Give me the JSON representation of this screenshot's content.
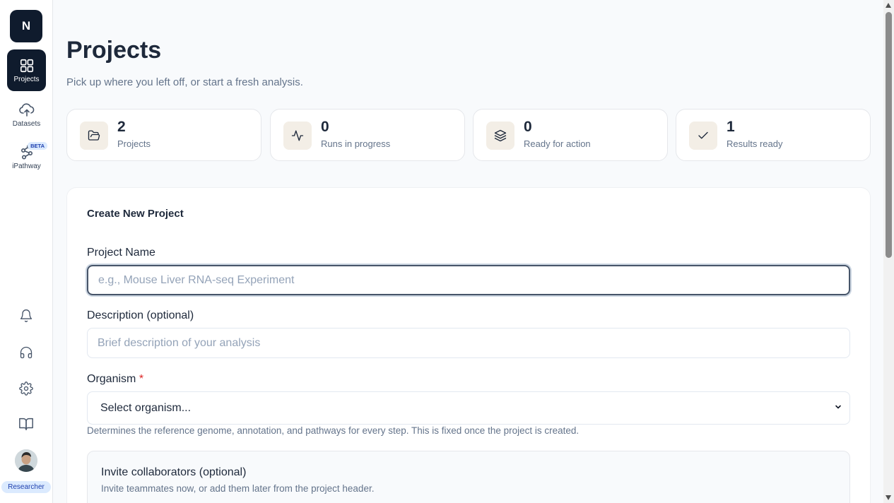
{
  "sidebar": {
    "logo_letter": "N",
    "nav": [
      {
        "label": "Projects",
        "icon": "grid-icon",
        "active": true
      },
      {
        "label": "Datasets",
        "icon": "cloud-upload-icon"
      },
      {
        "label": "iPathway",
        "icon": "pathway-icon",
        "badge": "BETA"
      }
    ],
    "utility_icons": [
      "bell-icon",
      "headphones-icon",
      "gear-icon",
      "book-icon"
    ],
    "role_badge": "Researcher"
  },
  "header": {
    "title": "Projects",
    "subtitle": "Pick up where you left off, or start a fresh analysis."
  },
  "stats": [
    {
      "value": "2",
      "label": "Projects",
      "icon": "folder-open-icon"
    },
    {
      "value": "0",
      "label": "Runs in progress",
      "icon": "activity-icon"
    },
    {
      "value": "0",
      "label": "Ready for action",
      "icon": "layers-icon"
    },
    {
      "value": "1",
      "label": "Results ready",
      "icon": "check-icon"
    }
  ],
  "form": {
    "title": "Create New Project",
    "project_name": {
      "label": "Project Name",
      "placeholder": "e.g., Mouse Liver RNA-seq Experiment",
      "value": ""
    },
    "description": {
      "label": "Description (optional)",
      "placeholder": "Brief description of your analysis",
      "value": ""
    },
    "organism": {
      "label": "Organism",
      "required_mark": "*",
      "selected": "Select organism...",
      "help": "Determines the reference genome, annotation, and pathways for every step. This is fixed once the project is created."
    },
    "invite": {
      "title": "Invite collaborators (optional)",
      "subtitle": "Invite teammates now, or add them later from the project header."
    }
  },
  "colors": {
    "brand_dark": "#0f1b2d",
    "stat_icon_bg": "#f3eee6",
    "badge_bg": "#dbeafe",
    "required": "#dc2626"
  }
}
